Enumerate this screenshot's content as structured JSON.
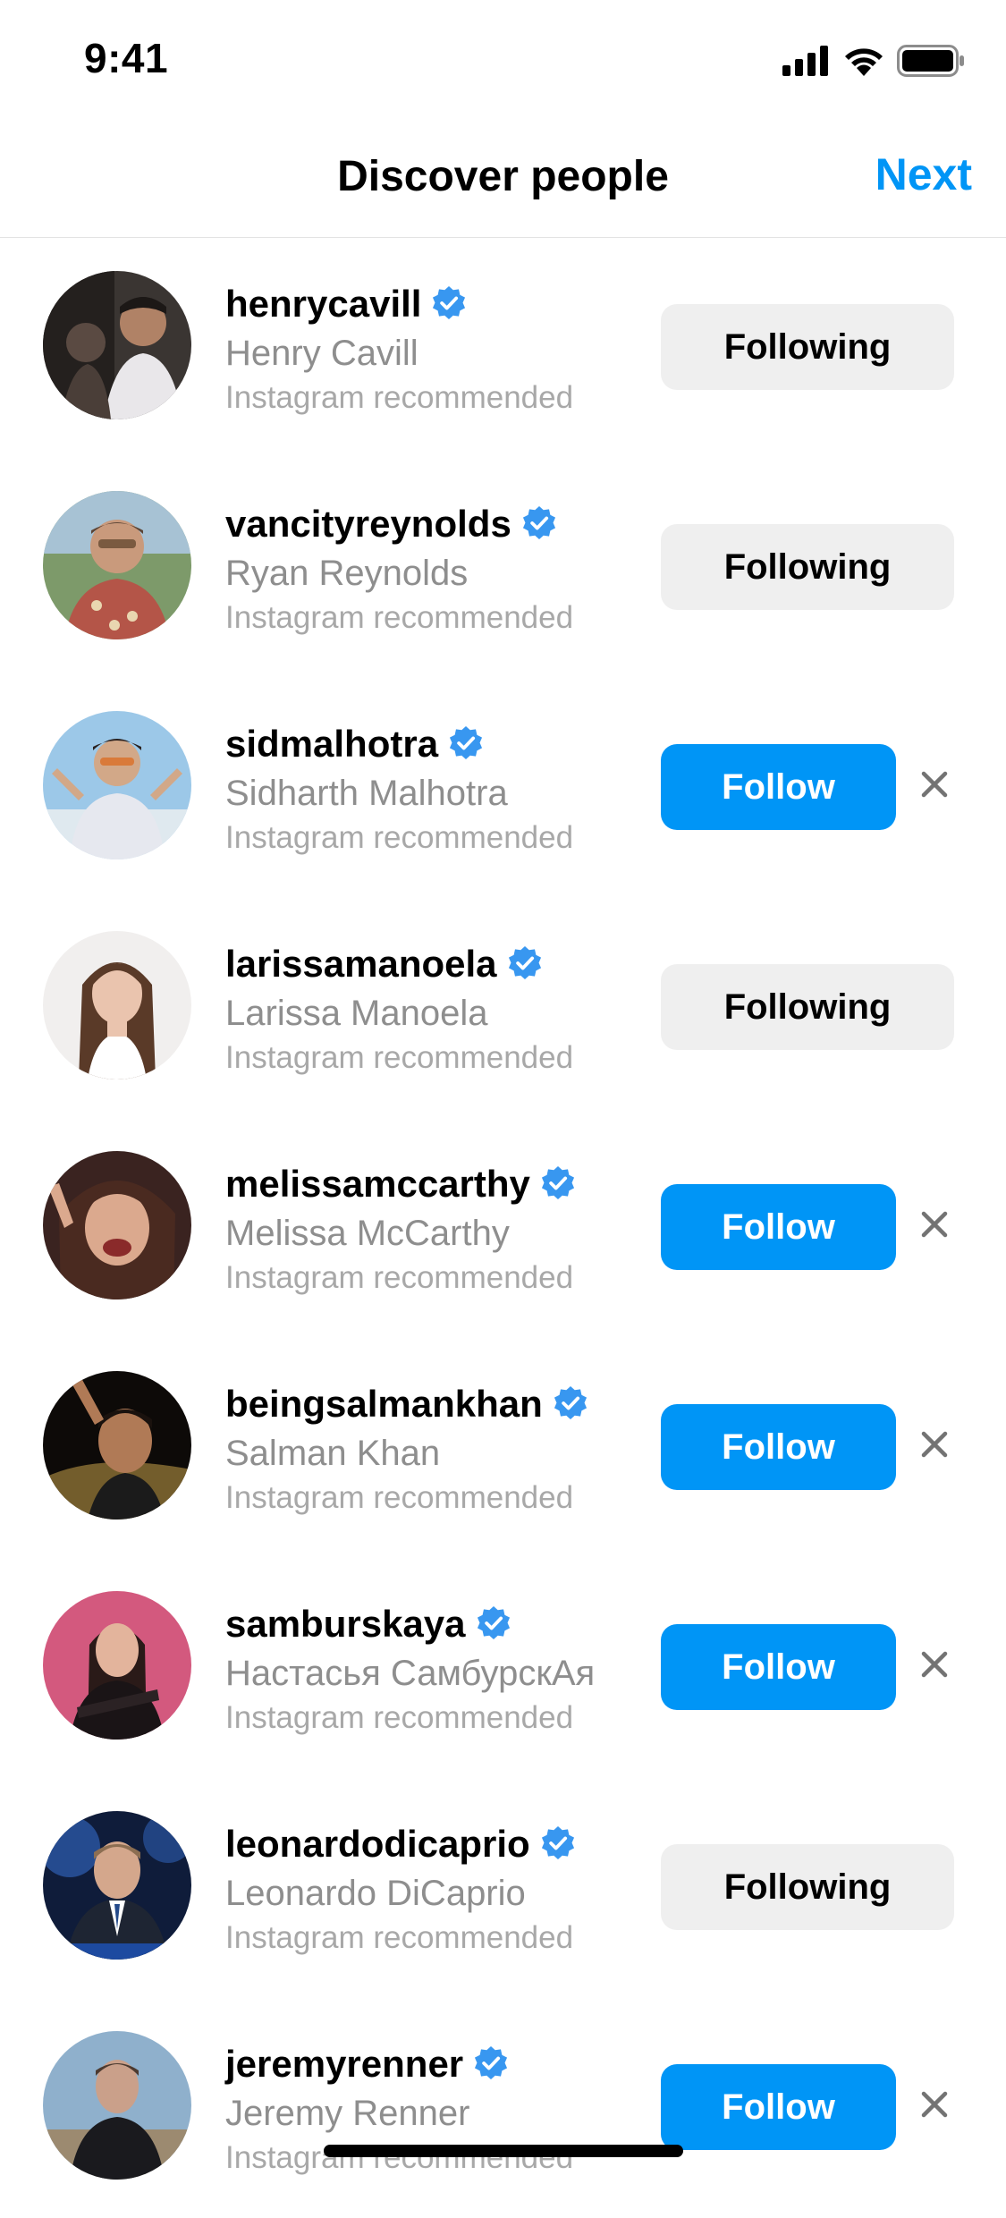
{
  "status_bar": {
    "time": "9:41"
  },
  "header": {
    "title": "Discover people",
    "next_label": "Next"
  },
  "colors": {
    "accent": "#0095f6",
    "verified": "#3897f0",
    "following_bg": "#efefef"
  },
  "icons": {
    "verified": "verified-badge-icon",
    "dismiss": "close-icon"
  },
  "people": [
    {
      "username": "henrycavill",
      "full_name": "Henry Cavill",
      "subtext": "Instagram recommended",
      "button": "Following",
      "following": true
    },
    {
      "username": "vancityreynolds",
      "full_name": "Ryan Reynolds",
      "subtext": "Instagram recommended",
      "button": "Following",
      "following": true
    },
    {
      "username": "sidmalhotra",
      "full_name": "Sidharth Malhotra",
      "subtext": "Instagram recommended",
      "button": "Follow",
      "following": false
    },
    {
      "username": "larissamanoela",
      "full_name": "Larissa Manoela",
      "subtext": "Instagram recommended",
      "button": "Following",
      "following": true
    },
    {
      "username": "melissamccarthy",
      "full_name": "Melissa McCarthy",
      "subtext": "Instagram recommended",
      "button": "Follow",
      "following": false
    },
    {
      "username": "beingsalmankhan",
      "full_name": "Salman Khan",
      "subtext": "Instagram recommended",
      "button": "Follow",
      "following": false
    },
    {
      "username": "samburskaya",
      "full_name": "Настасья СамбурскАя",
      "subtext": "Instagram recommended",
      "button": "Follow",
      "following": false
    },
    {
      "username": "leonardodicaprio",
      "full_name": "Leonardo DiCaprio",
      "subtext": "Instagram recommended",
      "button": "Following",
      "following": true
    },
    {
      "username": "jeremyrenner",
      "full_name": "Jeremy Renner",
      "subtext": "Instagram recommended",
      "button": "Follow",
      "following": false
    }
  ]
}
